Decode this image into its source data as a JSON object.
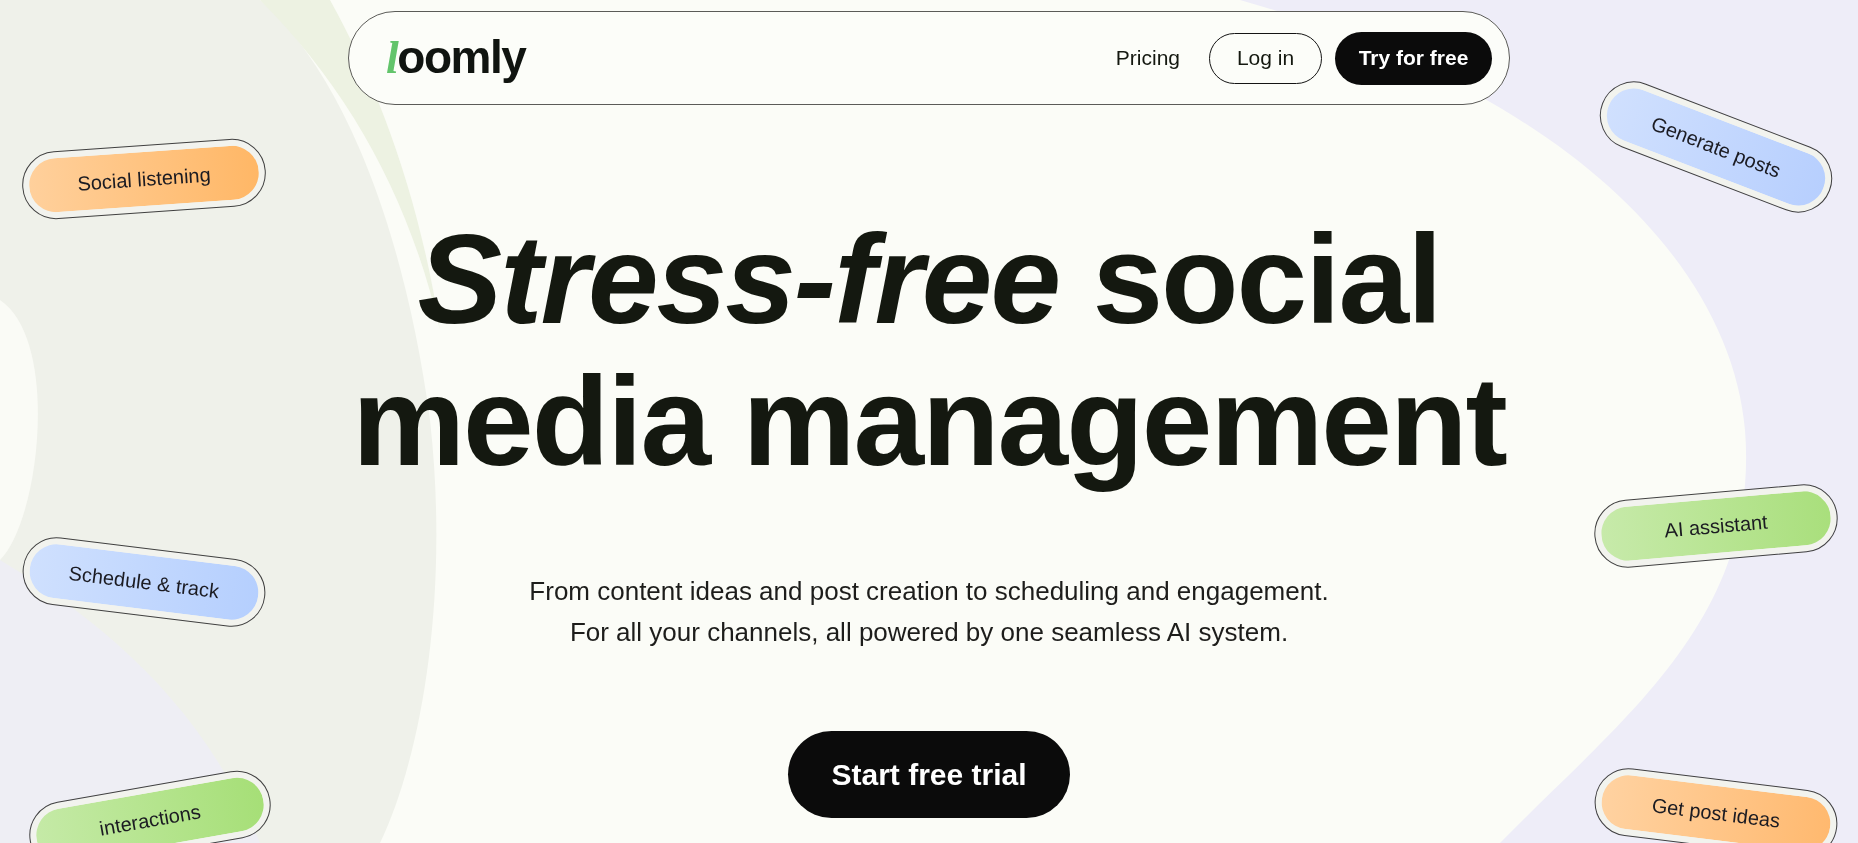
{
  "nav": {
    "logo": "loomly",
    "links": [
      {
        "label": "Pricing",
        "kind": "link"
      },
      {
        "label": "Log in",
        "kind": "outline"
      },
      {
        "label": "Try for free",
        "kind": "solid"
      }
    ]
  },
  "hero": {
    "title": "*Stress-free* social media management",
    "subtitle_lines": [
      "From content ideas and post creation to scheduling and engagement.",
      "For all your channels, all powered by one seamless AI system."
    ],
    "cta": "Start free trial"
  },
  "left_tags": [
    {
      "label": "Social listening",
      "color": "#ffb766"
    },
    {
      "label": "Schedule & track",
      "color": "#b5cffe"
    },
    {
      "label": "interactions",
      "color": "#a6df77"
    }
  ],
  "right_tags": [
    {
      "label": "Generate posts",
      "color": "#b7cffe"
    },
    {
      "label": "AI assistant",
      "color": "#a9df7c"
    },
    {
      "label": "Get post ideas",
      "color": "#ffb96f"
    }
  ]
}
